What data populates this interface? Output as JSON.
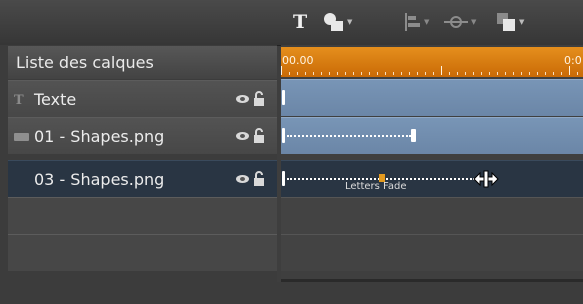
{
  "toolbar": {
    "text_tool": "T",
    "tools": [
      {
        "icon": "shapes-icon",
        "state": "enabled"
      },
      {
        "icon": "align-icon",
        "state": "disabled"
      },
      {
        "icon": "link-icon",
        "state": "disabled"
      },
      {
        "icon": "arrange-icon",
        "state": "enabled"
      }
    ]
  },
  "layers_panel": {
    "header": "Liste des calques",
    "rows": [
      {
        "name": "Texte",
        "type_icon": "text-icon",
        "selected": false
      },
      {
        "name": "01 - Shapes.png",
        "type_icon": "image-icon",
        "selected": false
      },
      {
        "name": "03 - Shapes.png",
        "type_icon": "image-icon",
        "selected": true
      }
    ]
  },
  "timeline": {
    "ruler_start": "00.00",
    "ruler_end": "0:0",
    "effect_label": "Letters Fade"
  },
  "colors": {
    "ruler": "#d77a10",
    "track": "#7290b1",
    "selected_row": "#293543",
    "keyframe_mid": "#e39a1f"
  }
}
